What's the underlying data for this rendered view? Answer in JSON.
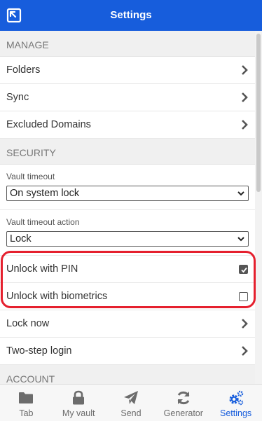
{
  "header": {
    "title": "Settings"
  },
  "manage": {
    "heading": "MANAGE",
    "items": [
      {
        "label": "Folders"
      },
      {
        "label": "Sync"
      },
      {
        "label": "Excluded Domains"
      }
    ]
  },
  "security": {
    "heading": "SECURITY",
    "vault_timeout": {
      "label": "Vault timeout",
      "value": "On system lock"
    },
    "vault_timeout_action": {
      "label": "Vault timeout action",
      "value": "Lock"
    },
    "unlock_pin": {
      "label": "Unlock with PIN",
      "checked": true
    },
    "unlock_biometrics": {
      "label": "Unlock with biometrics",
      "checked": false
    },
    "lock_now": {
      "label": "Lock now"
    },
    "two_step": {
      "label": "Two-step login"
    }
  },
  "account": {
    "heading": "ACCOUNT"
  },
  "nav": {
    "tabs": [
      {
        "label": "Tab",
        "icon": "folder-icon"
      },
      {
        "label": "My vault",
        "icon": "lock-icon"
      },
      {
        "label": "Send",
        "icon": "paper-plane-icon"
      },
      {
        "label": "Generator",
        "icon": "refresh-icon"
      },
      {
        "label": "Settings",
        "icon": "cogs-icon",
        "active": true
      }
    ]
  },
  "colors": {
    "brand": "#175ddc",
    "highlight": "#e5202e"
  }
}
